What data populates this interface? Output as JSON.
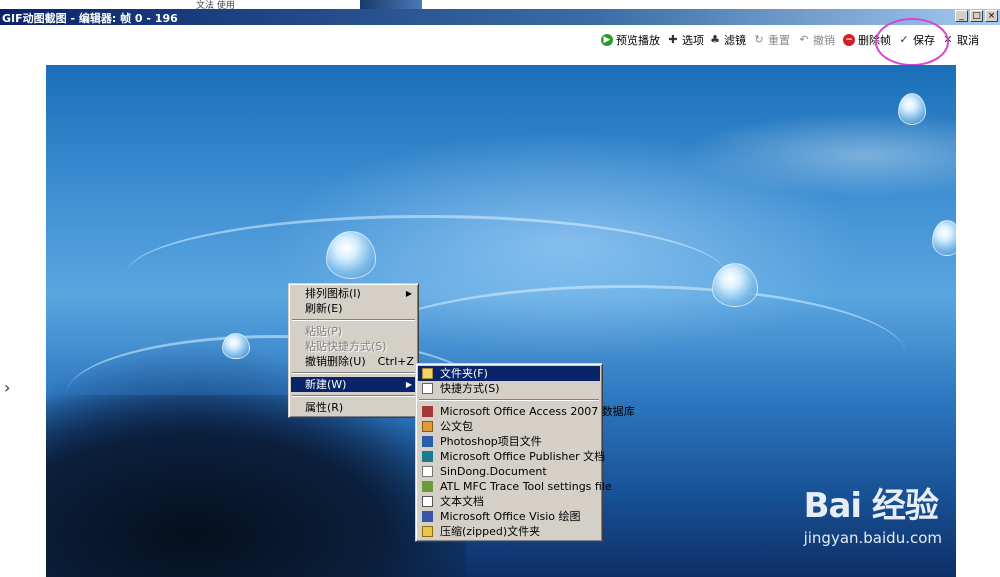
{
  "behind": {
    "tag_text": "文法 使用"
  },
  "window": {
    "title": "GIF动图截图 - 编辑器: 帧 0 - 196",
    "buttons": {
      "minimize": "_",
      "maximize": "□",
      "close": "×"
    }
  },
  "toolbar": {
    "preview": "预览播放",
    "options": "选项",
    "filter": "滤镜",
    "reset": "重置",
    "undo": "撤销",
    "delete_frame": "删除帧",
    "save": "保存",
    "cancel": "取消"
  },
  "nav": {
    "left_arrow": "›"
  },
  "context_menu": {
    "arrange_icons": "排列图标(I)",
    "refresh": "刷新(E)",
    "paste": "粘贴(P)",
    "paste_shortcut": "粘贴快捷方式(S)",
    "undo_delete": "撤销删除(U)",
    "undo_delete_shortcut": "Ctrl+Z",
    "new": "新建(W)",
    "properties": "属性(R)"
  },
  "submenu": {
    "folder": "文件夹(F)",
    "shortcut": "快捷方式(S)",
    "access": "Microsoft Office Access 2007 数据库",
    "briefcase": "公文包",
    "photoshop": "Photoshop项目文件",
    "publisher": "Microsoft Office Publisher 文档",
    "sindong": "SinDong.Document",
    "atl": "ATL MFC Trace Tool settings file",
    "text": "文本文档",
    "visio": "Microsoft Office Visio 绘图",
    "zip": "压缩(zipped)文件夹"
  },
  "watermark": {
    "brand": "Bai 经验",
    "url": "jingyan.baidu.com"
  },
  "colors": {
    "titlebar": "#0a246a",
    "menu_bg": "#d4d0c8",
    "menu_selected": "#0a246a",
    "highlight_circle": "#d246d2"
  }
}
